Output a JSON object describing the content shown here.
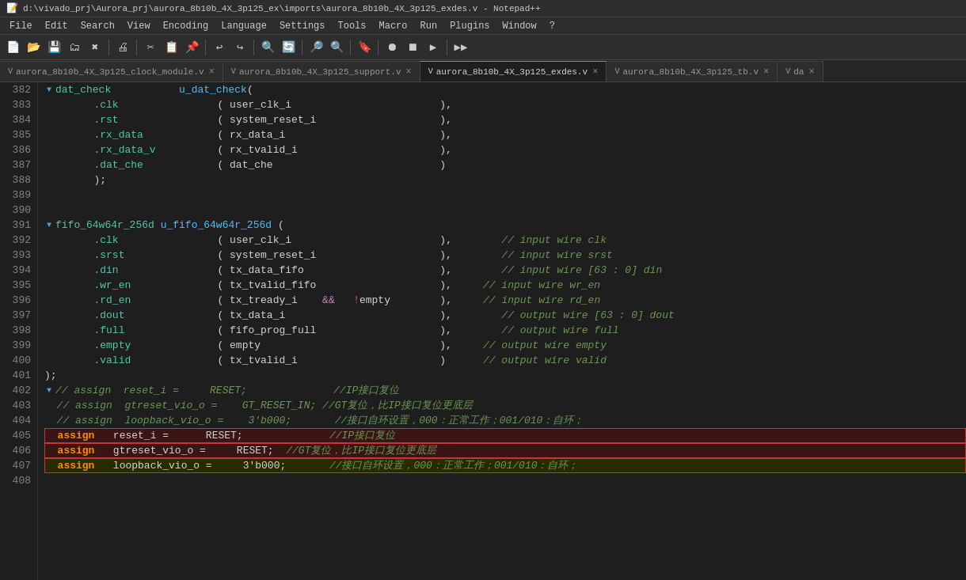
{
  "titlebar": {
    "text": "d:\\vivado_prj\\Aurora_prj\\aurora_8b10b_4X_3p125_ex\\imports\\aurora_8b10b_4X_3p125_exdes.v - Notepad++"
  },
  "menubar": {
    "items": [
      "File",
      "Edit",
      "Search",
      "View",
      "Encoding",
      "Language",
      "Settings",
      "Tools",
      "Macro",
      "Run",
      "Plugins",
      "Window",
      "?"
    ]
  },
  "tabs": [
    {
      "label": "aurora_8b10b_4X_3p125_clock_module.v",
      "active": false
    },
    {
      "label": "aurora_8b10b_4X_3p125_support.v",
      "active": false
    },
    {
      "label": "aurora_8b10b_4X_3p125_exdes.v",
      "active": true
    },
    {
      "label": "aurora_8b10b_4X_3p125_tb.v",
      "active": false
    },
    {
      "label": "da",
      "active": false
    }
  ],
  "lines": [
    {
      "num": "382",
      "content": "dat_check",
      "type": "module_start"
    },
    {
      "num": "383",
      "content": "    .clk                ( user_clk_i                        ),",
      "type": "port"
    },
    {
      "num": "384",
      "content": "    .rst                ( system_reset_i                    ),",
      "type": "port"
    },
    {
      "num": "385",
      "content": "    .rx_data            ( rx_data_i                         ),",
      "type": "port"
    },
    {
      "num": "386",
      "content": "    .rx_data_v          ( rx_tvalid_i                       ),",
      "type": "port"
    },
    {
      "num": "387",
      "content": "    .dat_che            ( dat_che                           )",
      "type": "port"
    },
    {
      "num": "388",
      "content": "    );",
      "type": "normal"
    },
    {
      "num": "389",
      "content": "",
      "type": "empty"
    },
    {
      "num": "390",
      "content": "",
      "type": "empty"
    },
    {
      "num": "391",
      "content": "fifo_64w64r_256d u_fifo_64w64r_256d (",
      "type": "module_start2"
    },
    {
      "num": "392",
      "content": "    .clk                ( user_clk_i                        ),        // input wire clk",
      "type": "port_comment"
    },
    {
      "num": "393",
      "content": "    .srst               ( system_reset_i                    ),        // input wire srst",
      "type": "port_comment"
    },
    {
      "num": "394",
      "content": "    .din                ( tx_data_fifo                      ),        // input wire [63 : 0] din",
      "type": "port_comment"
    },
    {
      "num": "395",
      "content": "    .wr_en              ( tx_tvalid_fifo                    ),     // input wire wr_en",
      "type": "port_comment"
    },
    {
      "num": "396",
      "content": "    .rd_en              ( tx_tready_i    &&   !empty        ),     // input wire rd_en",
      "type": "port_comment_special"
    },
    {
      "num": "397",
      "content": "    .dout               ( tx_data_i                         ),        // output wire [63 : 0] dout",
      "type": "port_comment"
    },
    {
      "num": "398",
      "content": "    .full               ( fifo_prog_full                    ),        // output wire full",
      "type": "port_comment"
    },
    {
      "num": "399",
      "content": "    .empty              ( empty                             ),     // output wire empty",
      "type": "port_comment"
    },
    {
      "num": "400",
      "content": "    .valid              ( tx_tvalid_i                       )      // output wire valid",
      "type": "port_comment"
    },
    {
      "num": "401",
      "content": ");",
      "type": "normal"
    },
    {
      "num": "402",
      "content": "// assign  reset_i =     RESET;              //IP接口复位",
      "type": "comment_cn"
    },
    {
      "num": "403",
      "content": "// assign  gtreset_vio_o =    GT_RESET_IN; //GT复位，比IP接口复位更底层",
      "type": "comment_cn"
    },
    {
      "num": "404",
      "content": "// assign  loopback_vio_o =    3'b000;       //接口自环设置，000：正常工作；001/010：自环；",
      "type": "comment_cn"
    },
    {
      "num": "405",
      "content": "assign   reset_i =      RESET;              //IP接口复位",
      "type": "assign_highlight1"
    },
    {
      "num": "406",
      "content": "assign   gtreset_vio_o =     RESET;  //GT复位，比IP接口复位更底层",
      "type": "assign_highlight2"
    },
    {
      "num": "407",
      "content": "assign   loopback_vio_o =     3'b000;       //接口自环设置，000：正常工作；001/010：自环；",
      "type": "assign_highlight3"
    },
    {
      "num": "408",
      "content": "",
      "type": "empty"
    }
  ]
}
